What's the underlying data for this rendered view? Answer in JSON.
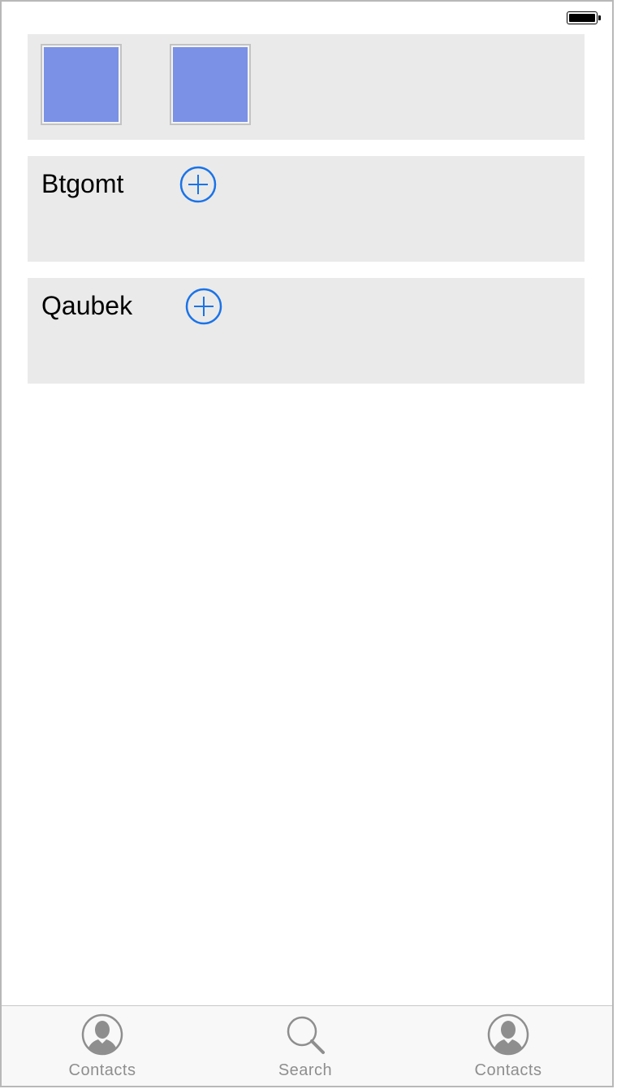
{
  "status_bar": {
    "battery_level": 1.0
  },
  "image_row": {
    "images": [
      {
        "fill_color": "#7a91e6"
      },
      {
        "fill_color": "#7a91e6"
      }
    ]
  },
  "list": {
    "rows": [
      {
        "label": "Btgomt",
        "action_icon": "add-circle-icon"
      },
      {
        "label": "Qaubek",
        "action_icon": "add-circle-icon"
      }
    ]
  },
  "tab_bar": {
    "tabs": [
      {
        "label": "Contacts",
        "icon": "contact-icon"
      },
      {
        "label": "Search",
        "icon": "search-icon"
      },
      {
        "label": "Contacts",
        "icon": "contact-icon"
      }
    ]
  },
  "colors": {
    "accent": "#1a73e8",
    "panel_bg": "#eaeaea",
    "image_fill": "#7a91e6",
    "tab_inactive": "#8e8e8e"
  }
}
